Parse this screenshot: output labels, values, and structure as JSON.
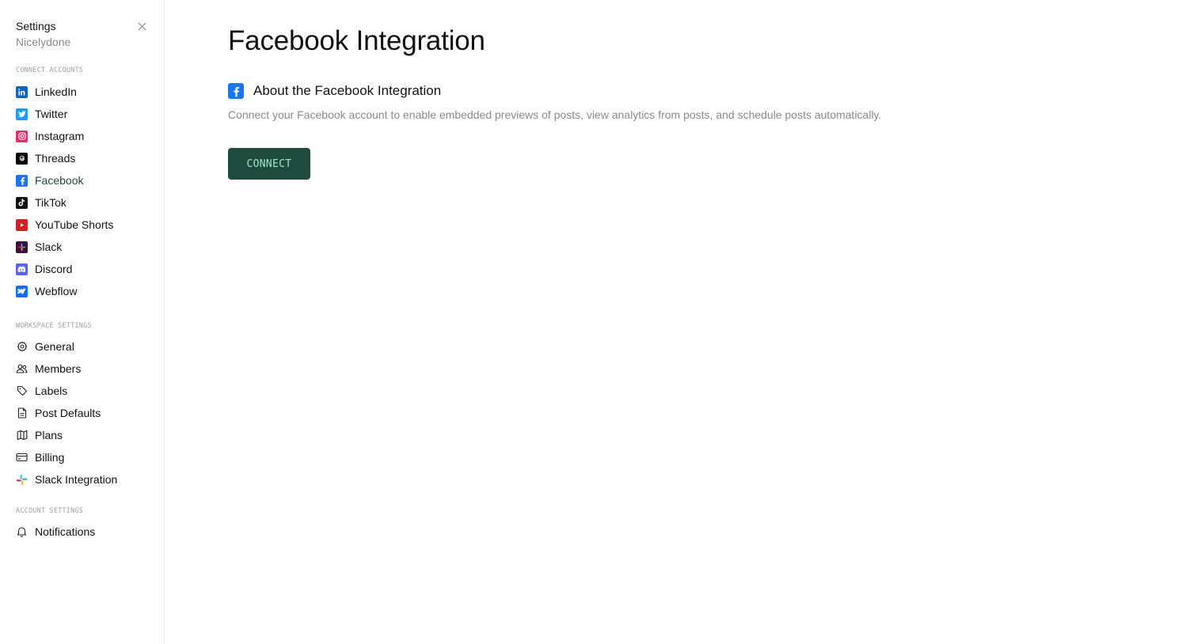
{
  "sidebar": {
    "title": "Settings",
    "workspace": "Nicelydone",
    "sections": {
      "connect_accounts": "CONNECT ACCOUNTS",
      "workspace_settings": "WORKSPACE SETTINGS",
      "account_settings": "ACCOUNT SETTINGS"
    },
    "connect_items": [
      {
        "label": "LinkedIn",
        "icon": "linkedin-icon",
        "color": "#0a66c2"
      },
      {
        "label": "Twitter",
        "icon": "twitter-icon",
        "color": "#1d9bf0"
      },
      {
        "label": "Instagram",
        "icon": "instagram-icon",
        "color": "#e1306c"
      },
      {
        "label": "Threads",
        "icon": "threads-icon",
        "color": "#000000"
      },
      {
        "label": "Facebook",
        "icon": "facebook-icon",
        "color": "#1877f2"
      },
      {
        "label": "TikTok",
        "icon": "tiktok-icon",
        "color": "#111111"
      },
      {
        "label": "YouTube Shorts",
        "icon": "youtube-shorts-icon",
        "color": "#d32020"
      },
      {
        "label": "Slack",
        "icon": "slack-icon",
        "color": "#3f0e40"
      },
      {
        "label": "Discord",
        "icon": "discord-icon",
        "color": "#5865f2"
      },
      {
        "label": "Webflow",
        "icon": "webflow-icon",
        "color": "#146ef5"
      }
    ],
    "workspace_items": [
      {
        "label": "General",
        "icon": "gear-icon"
      },
      {
        "label": "Members",
        "icon": "members-icon"
      },
      {
        "label": "Labels",
        "icon": "tag-icon"
      },
      {
        "label": "Post Defaults",
        "icon": "document-icon"
      },
      {
        "label": "Plans",
        "icon": "map-icon"
      },
      {
        "label": "Billing",
        "icon": "credit-card-icon"
      },
      {
        "label": "Slack Integration",
        "icon": "slack-color-icon"
      }
    ],
    "account_items": [
      {
        "label": "Notifications",
        "icon": "bell-icon"
      }
    ],
    "active": "Facebook"
  },
  "main": {
    "title": "Facebook Integration",
    "about_title": "About the Facebook Integration",
    "description": "Connect your Facebook account to enable embedded previews of posts, view analytics from posts, and schedule posts automatically.",
    "connect_label": "CONNECT"
  },
  "colors": {
    "accent": "#1f4a3e",
    "accent_text": "#9fe3c8",
    "facebook": "#1877f2"
  }
}
